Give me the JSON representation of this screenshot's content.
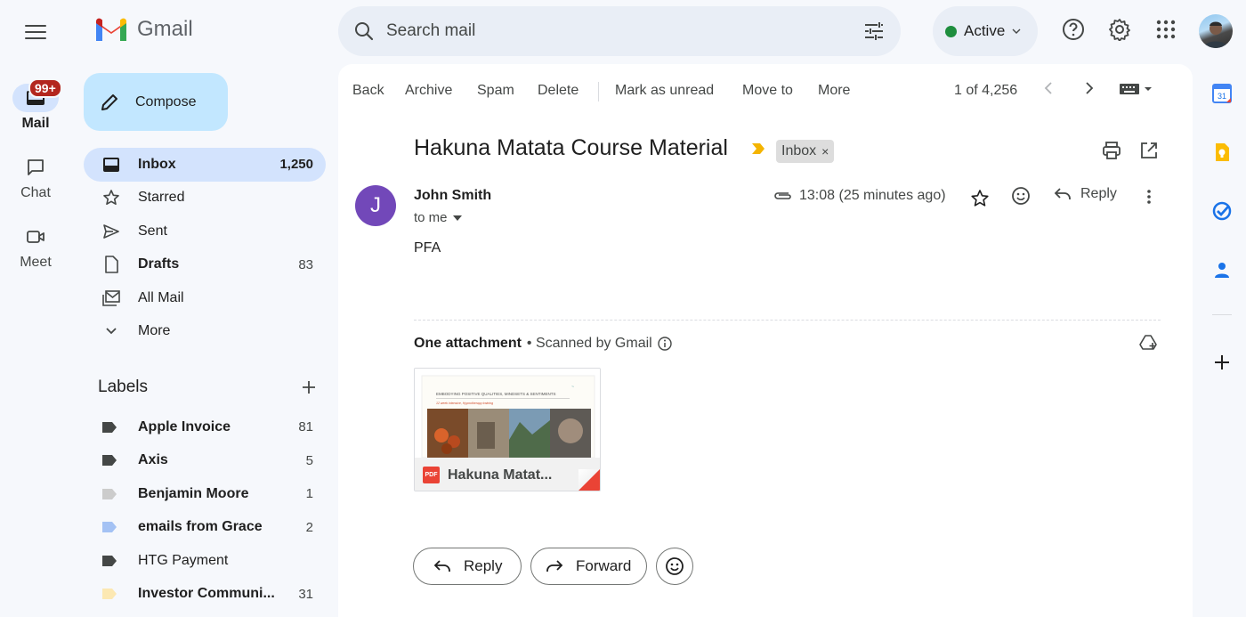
{
  "app": {
    "name": "Gmail"
  },
  "rail": {
    "mail_label": "Mail",
    "mail_badge": "99+",
    "chat_label": "Chat",
    "meet_label": "Meet"
  },
  "compose_label": "Compose",
  "nav": [
    {
      "label": "Inbox",
      "count": "1,250",
      "icon": "inbox-icon"
    },
    {
      "label": "Starred",
      "count": "",
      "icon": "star-icon"
    },
    {
      "label": "Sent",
      "count": "",
      "icon": "send-icon"
    },
    {
      "label": "Drafts",
      "count": "83",
      "icon": "draft-icon"
    },
    {
      "label": "All Mail",
      "count": "",
      "icon": "all-mail-icon"
    },
    {
      "label": "More",
      "count": "",
      "icon": "chevron-down-icon"
    }
  ],
  "labels_title": "Labels",
  "labels": [
    {
      "name": "Apple Invoice",
      "count": "81",
      "color": "#444746"
    },
    {
      "name": "Axis",
      "count": "5",
      "color": "#444746"
    },
    {
      "name": "Benjamin Moore",
      "count": "1",
      "color": "#cccccc"
    },
    {
      "name": "emails from Grace",
      "count": "2",
      "color": "#a4c2f4"
    },
    {
      "name": "HTG Payment",
      "count": "",
      "color": "#444746"
    },
    {
      "name": "Investor Communi...",
      "count": "31",
      "color": "#fce8b2"
    }
  ],
  "search": {
    "placeholder": "Search mail"
  },
  "status": {
    "label": "Active",
    "color": "#1e8e3e"
  },
  "toolbar": {
    "back": "Back",
    "archive": "Archive",
    "spam": "Spam",
    "delete": "Delete",
    "mark_unread": "Mark as unread",
    "move_to": "Move to",
    "more": "More",
    "pager": "1 of 4,256"
  },
  "email": {
    "subject": "Hakuna Matata Course Material",
    "label_chip": "Inbox",
    "sender_initial": "J",
    "sender_name": "John Smith",
    "recipient": "to me",
    "time": "13:08 (25 minutes ago)",
    "reply_label": "Reply",
    "body": "PFA",
    "attachment_header": "One attachment",
    "scanned": "• Scanned by Gmail",
    "attachment_name": "Hakuna Matat...",
    "attachment_type": "PDF",
    "preview_heading": "EMBODYING POSITIVE QUALITIES, MINDSETS & SENTIMENTS",
    "preview_subheading": "12 week intensive, Hypnotherapy training"
  },
  "actions": {
    "reply": "Reply",
    "forward": "Forward"
  },
  "colors": {
    "accent": "#0b57d0",
    "compose_bg": "#c2e7ff",
    "nav_active": "#d3e3fd",
    "avatar": "#7248b9",
    "badge": "#b3261e"
  }
}
